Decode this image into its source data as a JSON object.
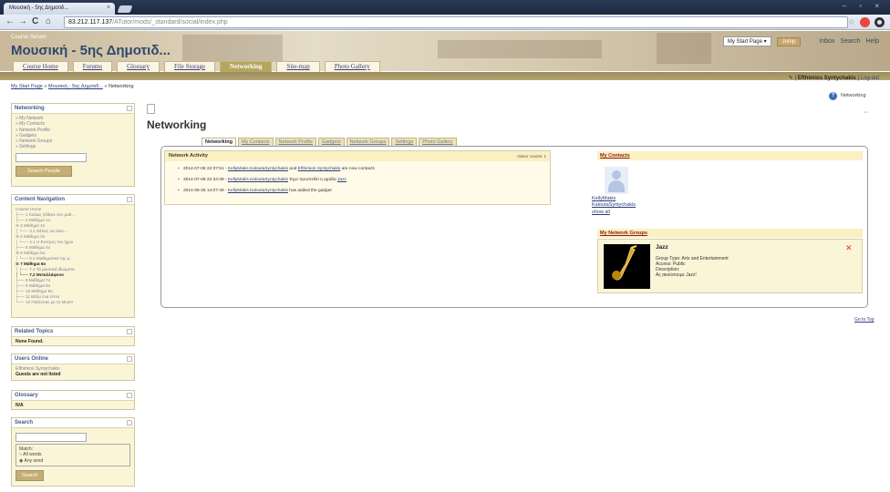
{
  "browser": {
    "tab_title": "Μουσική - 5ης Δημοτιδ...",
    "tab_close": "×",
    "url_host": "83.212.117.137",
    "url_path": "/ATutor/mods/_standard/social/index.php",
    "back": "←",
    "forward": "→",
    "reload": "C",
    "home": "⌂",
    "window_controls": "– ▫ ×"
  },
  "header": {
    "server_label": "Course Server",
    "course_title": "Μουσική - 5ης Δημοτιδ...",
    "start_page_select": "My Start Page ▾",
    "jump_label": "Jump",
    "inbox": "Inbox",
    "search": "Search",
    "help": "Help"
  },
  "nav_tabs": [
    {
      "label": "Course Home"
    },
    {
      "label": "Forums"
    },
    {
      "label": "Glossary"
    },
    {
      "label": "File Storage"
    },
    {
      "label": "Networking"
    },
    {
      "label": "Site-map"
    },
    {
      "label": "Photo Gallery"
    }
  ],
  "user": {
    "name": "Efthimios Syntychakis",
    "logout": "Log-out",
    "pencil": "✎"
  },
  "breadcrumb": {
    "home": "My Start Page",
    "course": "Μουσική - 5ης Δημοτιδ...",
    "current": "Networking",
    "sep": "»"
  },
  "sidebar": {
    "networking": {
      "title": "Networking",
      "items": [
        "My Network",
        "My Contacts",
        "Network Profile",
        "Gadgets",
        "Network Groups",
        "Settings"
      ],
      "search_button": "Search People"
    },
    "content_nav": {
      "title": "Content Navigation",
      "items": [
        "Course Home",
        "1 Καλώς ήλθατε στο μαθ...",
        "2 Μάθημα 1ο",
        "3 Μάθημα 2ο",
        "3.1 Θέλεις να είναι...",
        "4 Μάθημα 3ο",
        "4.1 Η Εντεχνη του ήχου",
        "5 Μάθημα 4ο",
        "6 Μάθημα 5ο",
        "6.1 Μαθηματικά της μ...",
        "7 Μάθημα 6ο",
        "7.1 Τα μουσικά ιδιώματα",
        "7.2 Μεταλλάφονο",
        "8 Μάθημα 7ο",
        "9 Μάθημα 8ο",
        "10 Μάθημα 9ο",
        "11 Βάζω ένα ύπνο",
        "12 Παίζοντας με το Muzer"
      ]
    },
    "related": {
      "title": "Related Topics",
      "value": "None Found."
    },
    "users_online": {
      "title": "Users Online",
      "user": "Efthimios Syntychakis",
      "note": "Guests are not listed"
    },
    "glossary": {
      "title": "Glossary",
      "value": "N/A"
    },
    "search": {
      "title": "Search",
      "match_label": "Match:",
      "all_words": "All words",
      "any_word": "Any word",
      "button": "Search"
    }
  },
  "main": {
    "title": "Networking",
    "help_label": "Networking",
    "toggle": "⇔",
    "subtabs": [
      "Networking",
      "My Contacts",
      "Network Profile",
      "Gadgets",
      "Network Groups",
      "Settings",
      "Photo Gallery"
    ],
    "activity": {
      "title": "Network Activity",
      "visitor_count": "Visitor counts: 1",
      "items": [
        {
          "time": "2014-07-08 22:37:51 -",
          "a": "KellyMakis KaloutaSyntychakis",
          "mid": "and",
          "b": "Efthimios Syntychakis",
          "tail": "are now contacts"
        },
        {
          "time": "2014-07-08 22:34:39 -",
          "a": "KellyMakis KaloutaSyntychakis",
          "mid": "",
          "b": "",
          "tail": "Έχει προστεθεί η ομάδα",
          "link": "Jazz"
        },
        {
          "time": "2014-05-26 14:07:49 -",
          "a": "KellyMakis KaloutaSyntychakis",
          "mid": "",
          "b": "",
          "tail": "has added the gadget"
        }
      ]
    },
    "contacts": {
      "title": "My Contacts",
      "name1": "KellyMakis",
      "name2": "KaloutaSyntychakis",
      "show_all": "show all"
    },
    "groups": {
      "title": "My Network Groups",
      "name": "Jazz",
      "type": "Group Type: Arts and Entertainment",
      "access": "Access: Public",
      "desc_label": "Description:",
      "desc": "Ας ακούσουμε Jazz!",
      "remove": "✕"
    },
    "go_top": "Go to Top"
  },
  "colors": {
    "accent": "#b5a65f",
    "link": "#2c3e7a",
    "panel_bg": "#fbf5d8"
  }
}
